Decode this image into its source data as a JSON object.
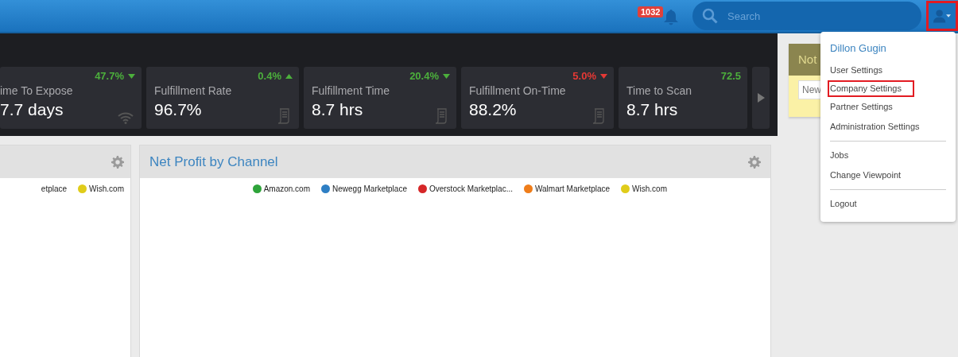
{
  "top_bar": {
    "notification_count": "1032",
    "search": {
      "placeholder": "Search"
    },
    "user_button": {
      "highlighted": true
    }
  },
  "kpis": [
    {
      "kind": "wifi",
      "title": "ime To Expose",
      "value": "7.7 days",
      "change": "47.7%",
      "up": false,
      "down": true,
      "color": "#4caf3c"
    },
    {
      "kind": "receipt",
      "title": "Fulfillment Rate",
      "value": "96.7%",
      "change": "0.4%",
      "up": true,
      "down": false,
      "color": "#4caf3c"
    },
    {
      "kind": "receipt",
      "title": "Fulfillment Time",
      "value": "8.7 hrs",
      "change": "20.4%",
      "up": false,
      "down": true,
      "color": "#4caf3c"
    },
    {
      "kind": "receipt",
      "title": "Fulfillment On-Time",
      "value": "88.2%",
      "change": "5.0%",
      "up": false,
      "down": true,
      "color": "#e53935"
    },
    {
      "kind": "plain",
      "title": "Time to Scan",
      "value": "8.7 hrs",
      "change": "72.5",
      "up": false,
      "down": false,
      "color": "#4caf3c"
    }
  ],
  "left_panel": {
    "legend": [
      {
        "label": "etplace"
      },
      {
        "label": "Wish.com",
        "color": "#e0cc1a"
      }
    ]
  },
  "main_panel": {
    "title": "Net Profit by Channel",
    "legend": [
      {
        "label": "Amazon.com",
        "color": "#2ea43a"
      },
      {
        "label": "Newegg Marketplace",
        "color": "#2e7fc4"
      },
      {
        "label": "Overstock Marketplac...",
        "color": "#d62728"
      },
      {
        "label": "Walmart Marketplace",
        "color": "#ef7d1a"
      },
      {
        "label": "Wish.com",
        "color": "#e0cc1a"
      }
    ]
  },
  "notes": {
    "title": "Not",
    "placeholder": "New"
  },
  "user_menu": {
    "user_name": "Dillon Gugin",
    "groups": [
      [
        {
          "label": "User Settings",
          "highlighted": false
        },
        {
          "label": "Company Settings",
          "highlighted": true
        },
        {
          "label": "Partner Settings",
          "highlighted": false
        },
        {
          "label": "Administration Settings",
          "highlighted": false
        }
      ],
      [
        {
          "label": "Jobs",
          "highlighted": false
        },
        {
          "label": "Change Viewpoint",
          "highlighted": false
        }
      ],
      [
        {
          "label": "Logout",
          "highlighted": false
        }
      ]
    ]
  }
}
